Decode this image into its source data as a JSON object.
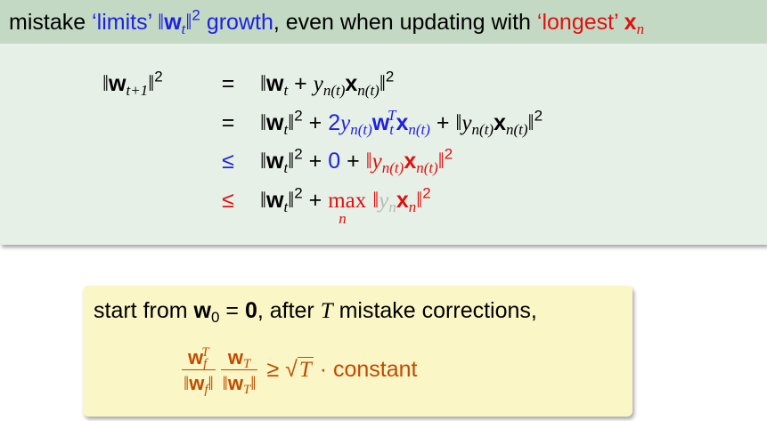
{
  "block": {
    "title": {
      "t1": "mistake ",
      "t2": "‘limits’ ",
      "t3": "‖",
      "t4": "w",
      "t5": "t",
      "t6": "‖",
      "t7": "2",
      "t8": " growth",
      "t9": ", even when updating with ",
      "t10": "‘longest’ ",
      "t11": "x",
      "t12": "n"
    },
    "rows": [
      {
        "lhs_a": "‖",
        "lhs_w": "w",
        "lhs_sub": "t+1",
        "lhs_b": "‖",
        "lhs_sup": "2",
        "rel": "=",
        "rhs": "‖w_t + y_n(t) x_n(t)‖^2"
      },
      {
        "rel": "=",
        "rhs": "‖w_t‖^2 + 2y_n(t) w_t^T x_n(t) + ‖y_n(t) x_n(t)‖^2"
      },
      {
        "rel": "≤",
        "rhs": "‖w_t‖^2 + 0 + ‖y_n(t) x_n(t)‖^2"
      },
      {
        "rel": "≤",
        "rhs": "‖w_t‖^2 + max_n ‖y_n x_n‖^2"
      }
    ]
  },
  "box": {
    "line1_a": "start from ",
    "line1_w": "w",
    "line1_sub0": "0",
    "line1_eq": " = ",
    "line1_zero": "0",
    "line1_b": ", after ",
    "line1_T": "T",
    "line1_c": " mistake corrections,",
    "formula": {
      "geq": "≥",
      "sqrt_sym": "√",
      "T": "T",
      "dot": "·",
      "constant": "constant"
    }
  },
  "colors": {
    "blue": "#1f1fe6",
    "red": "#e01010",
    "orange": "#c24a00",
    "header_bg": "#c3d9c3",
    "block_bg": "#e6f0e6",
    "box_bg": "#fbf6c6"
  }
}
